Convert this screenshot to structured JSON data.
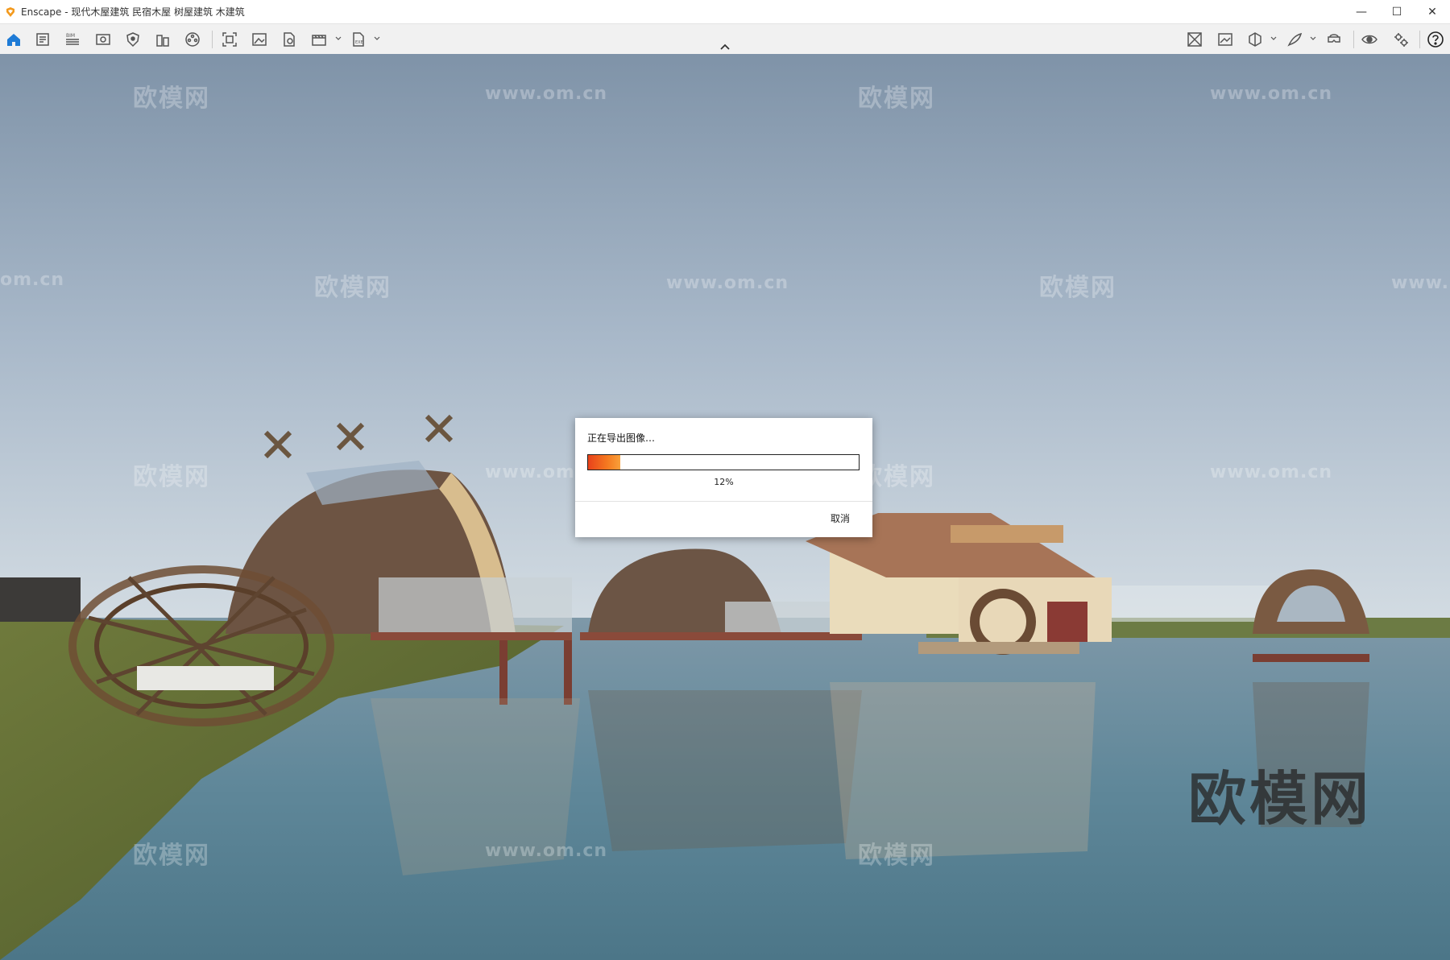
{
  "window": {
    "title": "Enscape - 现代木屋建筑 民宿木屋 树屋建筑 木建筑",
    "minimize": "—",
    "maximize": "☐",
    "close": "✕"
  },
  "toolbar": {
    "left_icons": [
      "home-icon",
      "sketch-icon",
      "bim-icon",
      "view-icon",
      "shield-icon",
      "buildings-icon",
      "film-icon",
      "capture-icon",
      "image-icon",
      "document-icon",
      "video-icon",
      "export-icon"
    ],
    "right_icons": [
      "asset-library-icon",
      "gallery-icon",
      "cube-icon",
      "feather-icon",
      "vr-headset-icon",
      "eye-icon",
      "settings-icon",
      "help-icon"
    ],
    "accent": "#1e7bd6"
  },
  "watermarks": {
    "brand": "欧模网",
    "url": "www.om.cn",
    "url_fragment_left": "om.cn",
    "url_fragment_right": "www."
  },
  "dialog": {
    "title": "正在导出图像…",
    "progress": 0.12,
    "percent_label": "12%",
    "cancel_label": "取消"
  }
}
